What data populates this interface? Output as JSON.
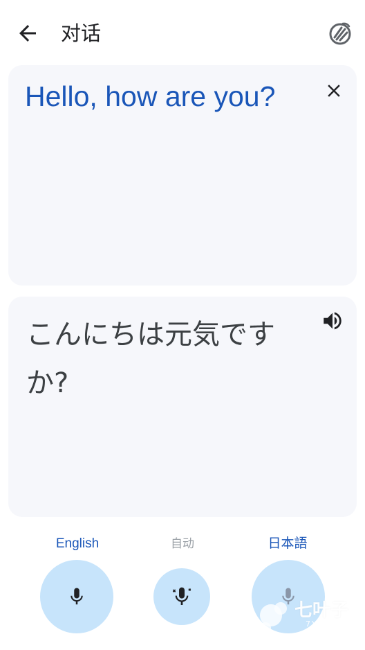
{
  "header": {
    "title": "对话",
    "back_icon": "arrow-back-icon",
    "hand_icon": "hand-wave-icon"
  },
  "source": {
    "text": "Hello, how are you?",
    "clear_icon": "close-icon"
  },
  "target": {
    "text": "こんにちは元気ですか?",
    "speak_icon": "speaker-icon"
  },
  "languages": {
    "left": "English",
    "auto": "自动",
    "right": "日本語"
  },
  "colors": {
    "accent": "#1a56b8",
    "card_bg": "#f6f7fb",
    "mic_bg": "#c7e4fb"
  },
  "watermark": {
    "brand": "七叶子",
    "domain": "7YZ.COM"
  }
}
